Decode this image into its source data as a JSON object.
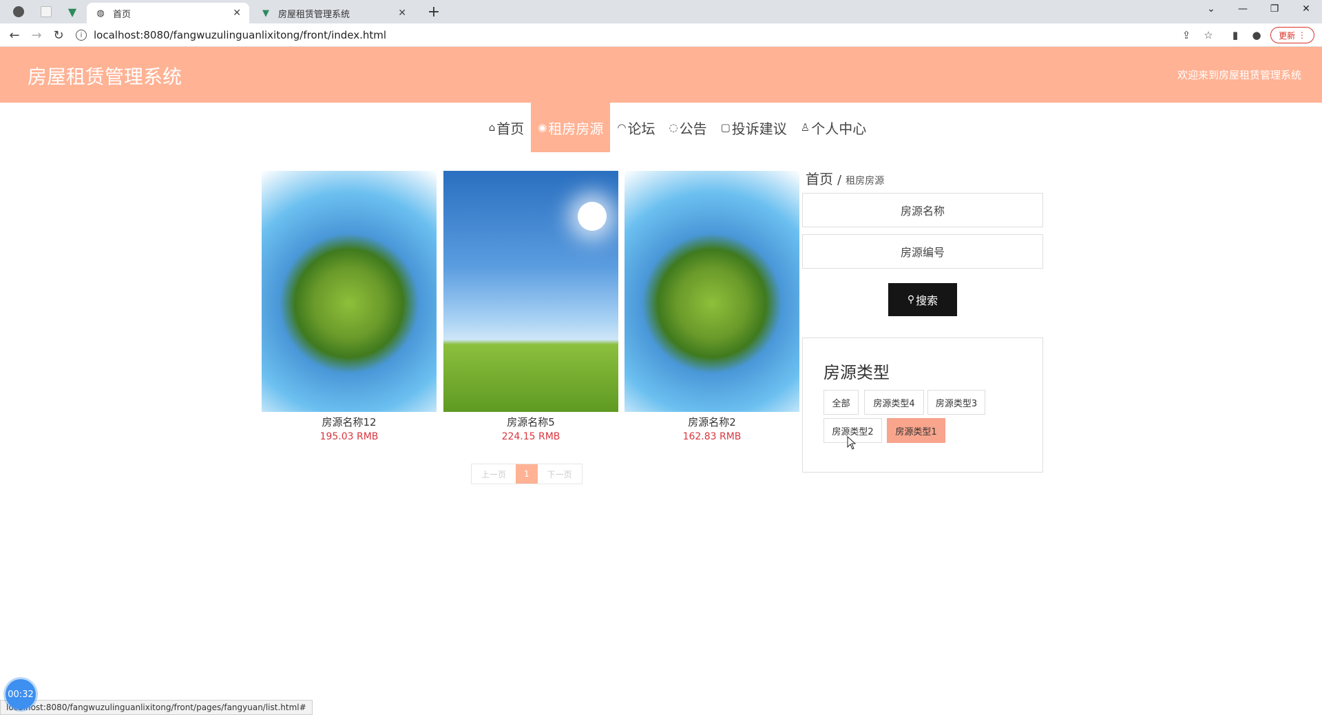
{
  "browser": {
    "tabs": [
      {
        "title": "首页",
        "active": true
      },
      {
        "title": "房屋租赁管理系统",
        "active": false
      }
    ],
    "url": "localhost:8080/fangwuzulinguanlixitong/front/index.html",
    "update_label": "更新",
    "status_url": "localhost:8080/fangwuzulinguanlixitong/front/pages/fangyuan/list.html#"
  },
  "header": {
    "title": "房屋租赁管理系统",
    "welcome": "欢迎来到房屋租赁管理系统"
  },
  "nav": {
    "items": [
      {
        "icon": "⌂",
        "label": "首页"
      },
      {
        "icon": "◉",
        "label": "租房房源"
      },
      {
        "icon": "◠",
        "label": "论坛"
      },
      {
        "icon": "◌",
        "label": "公告"
      },
      {
        "icon": "▢",
        "label": "投诉建议"
      },
      {
        "icon": "♙",
        "label": "个人中心"
      }
    ],
    "active_index": 1
  },
  "listings": [
    {
      "name": "房源名称12",
      "price": "195.03 RMB",
      "image": "planet"
    },
    {
      "name": "房源名称5",
      "price": "224.15 RMB",
      "image": "sky"
    },
    {
      "name": "房源名称2",
      "price": "162.83 RMB",
      "image": "planet"
    }
  ],
  "pagination": {
    "prev": "上一页",
    "current": "1",
    "next": "下一页"
  },
  "breadcrumb": {
    "home": "首页",
    "sep": "/",
    "current": "租房房源"
  },
  "search": {
    "name_placeholder": "房源名称",
    "code_placeholder": "房源编号",
    "button_label": "搜索"
  },
  "types": {
    "title": "房源类型",
    "items": [
      "全部",
      "房源类型4",
      "房源类型3",
      "房源类型2",
      "房源类型1"
    ],
    "active": "房源类型1"
  },
  "timer": "00:32",
  "colors": {
    "accent": "#ffb294",
    "price": "#d9363e",
    "search_bg": "#151515"
  }
}
